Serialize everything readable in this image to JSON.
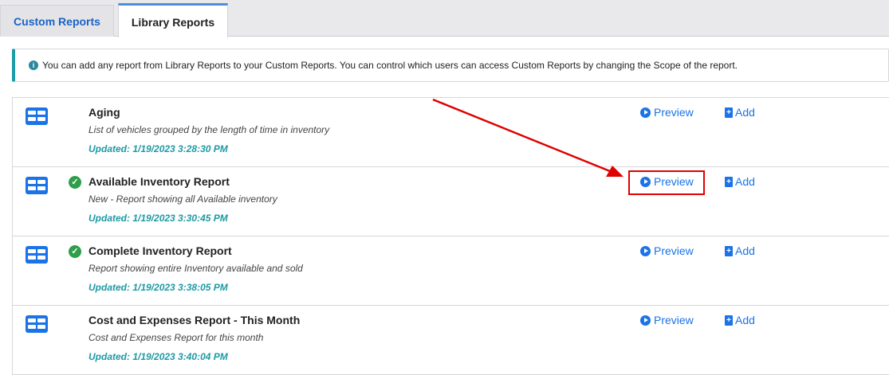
{
  "tabs": [
    {
      "label": "Custom Reports",
      "active": false
    },
    {
      "label": "Library Reports",
      "active": true
    }
  ],
  "info": {
    "icon": "info-icon",
    "text": "You can add any report from Library Reports to your Custom Reports. You can control which users can access Custom Reports by changing the Scope of the report."
  },
  "reports": [
    {
      "title": "Aging",
      "description": "List of vehicles grouped by the length of time in inventory",
      "updated": "Updated:  1/19/2023 3:28:30 PM",
      "checked": false,
      "preview_label": "Preview",
      "add_label": "Add"
    },
    {
      "title": "Available Inventory Report",
      "description": "New - Report showing all Available inventory",
      "updated": "Updated:  1/19/2023 3:30:45 PM",
      "checked": true,
      "preview_label": "Preview",
      "add_label": "Add"
    },
    {
      "title": "Complete Inventory Report",
      "description": "Report showing entire Inventory available and sold",
      "updated": "Updated:  1/19/2023 3:38:05 PM",
      "checked": true,
      "preview_label": "Preview",
      "add_label": "Add"
    },
    {
      "title": "Cost and Expenses Report - This Month",
      "description": "Cost and Expenses Report for this month",
      "updated": "Updated:  1/19/2023 3:40:04 PM",
      "checked": false,
      "preview_label": "Preview",
      "add_label": "Add"
    }
  ],
  "colors": {
    "accent": "#1a73e8",
    "teal": "#1e9aa4",
    "success": "#2e9e4a",
    "annotation": "#e00000"
  }
}
